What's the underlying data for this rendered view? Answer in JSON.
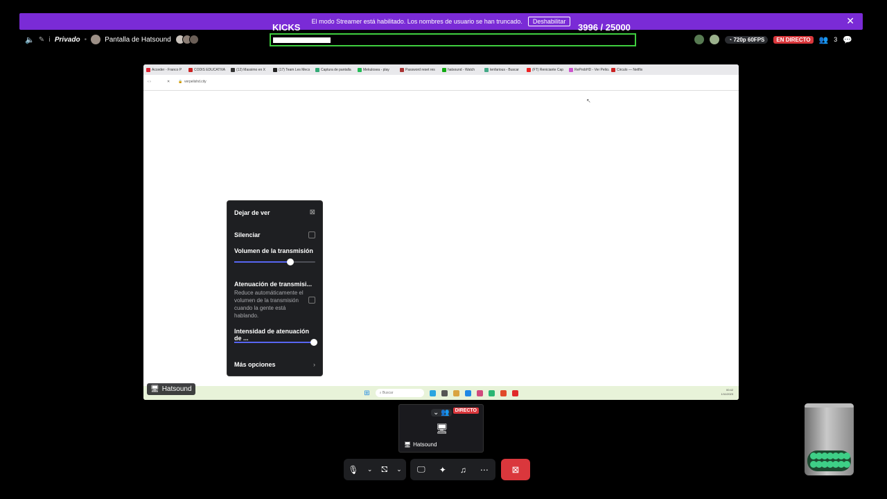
{
  "banner": {
    "message": "El modo Streamer está habilitado. Los nombres de usuario se han truncado.",
    "button_label": "Deshabilitar",
    "close_glyph": "✕"
  },
  "overlay": {
    "kicks_label": "KICKS",
    "counter": "3996  / 25000",
    "progress_fraction": 0.16
  },
  "header": {
    "channel_privacy": "Privado",
    "stream_title": "Pantalla de Hatsound",
    "quality": "720p 60FPS",
    "live_label": "EN DIRECTO",
    "viewer_count": "3"
  },
  "browser": {
    "tabs": [
      "Acceder ◦ Franco P",
      "CODIS EDUCATIVA",
      "(12) Massimo en X",
      "(17) Team Les Mecs",
      "Captura de pantalla",
      "Mekulosea - play",
      "Password reset res",
      "hatsound - Watch",
      "tenfarious - Buscar",
      "(FT) Reniciante Cap",
      "ReProbHD - Ver Pelicula",
      "Circulo — Netflix"
    ],
    "tab_colors": [
      "#d23",
      "#c22",
      "#333",
      "#222",
      "#3a7",
      "#2b5",
      "#a33",
      "#1a1",
      "#4a8",
      "#e22",
      "#c5c",
      "#c22"
    ],
    "url": "verpelishd.city",
    "taskbar_search": "Buscar",
    "clock_time": "00:42",
    "clock_date": "1/11/2023",
    "taskbar_icon_colors": [
      "#2aa5e0",
      "#555",
      "#d9a441",
      "#1e88e5",
      "#d04a7d",
      "#2bb673",
      "#e04a2a",
      "#e02a2a"
    ]
  },
  "stream_user": "Hatsound",
  "menu": {
    "stop_watching": "Dejar de ver",
    "mute": "Silenciar",
    "volume_label": "Volumen de la transmisión",
    "volume_value": 0.69,
    "attenuation_title": "Atenuación de transmisi...",
    "attenuation_desc": "Reduce automáticamente el volumen de la transmisión cuando la gente está hablando.",
    "intensity_label": "Intensidad de atenuación de ...",
    "intensity_value": 0.98,
    "more_options": "Más opciones"
  },
  "tile": {
    "live_label": "DIRECTO",
    "name": "Hatsound"
  },
  "controls": {
    "mic_icon": "microphone-icon",
    "camera_icon": "camera-off-icon",
    "share_icon": "screen-share-icon",
    "activities_icon": "activities-icon",
    "soundboard_icon": "soundboard-icon",
    "more_icon": "more-icon",
    "end_icon": "end-call-icon",
    "end_color": "#da373c",
    "accent": "#5865f2"
  }
}
